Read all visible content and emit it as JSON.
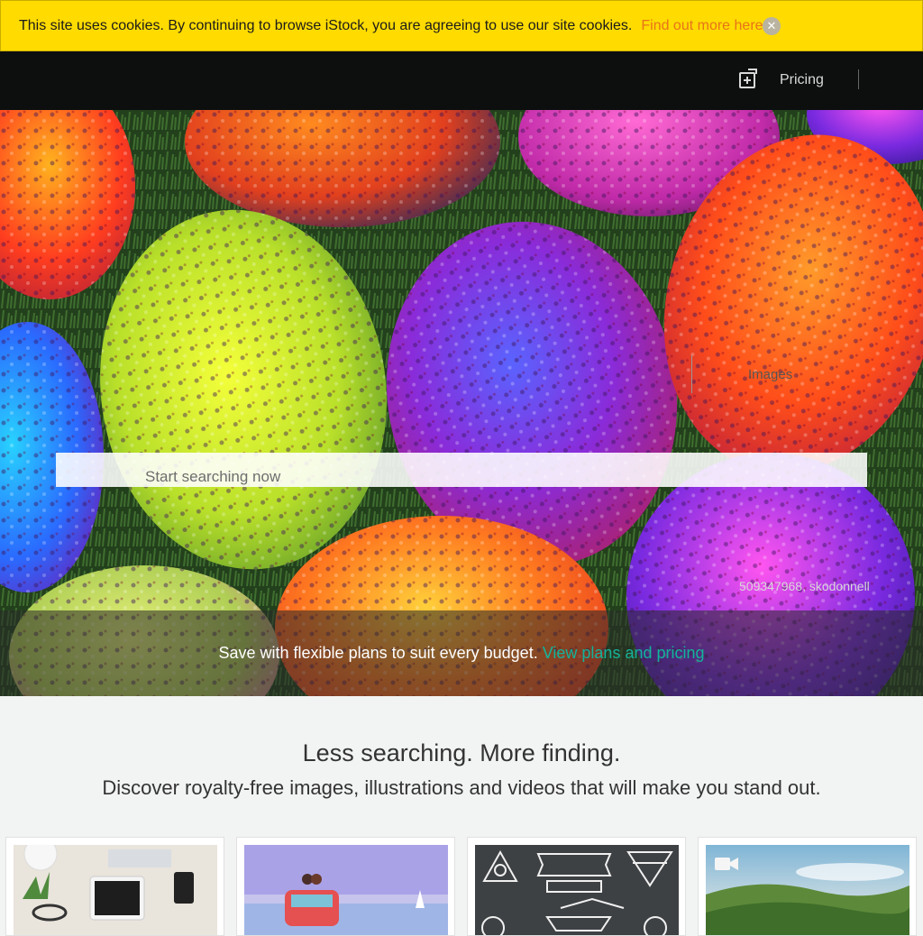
{
  "cookie": {
    "text": "This site uses cookies. By continuing to browse iStock, you are agreeing to use our site cookies.",
    "link": "Find out more here >",
    "close_icon": "close-icon"
  },
  "nav": {
    "pricing": "Pricing",
    "boards_icon": "add-board-icon"
  },
  "hero": {
    "search_placeholder": "Start searching now",
    "search_type": "Images",
    "credit": "509347968, skodonnell",
    "promo_text": "Save with flexible plans to suit every budget.",
    "promo_link": "View plans and pricing"
  },
  "intro": {
    "headline": "Less searching. More finding.",
    "subhead": "Discover royalty-free images, illustrations and videos that will make you stand out."
  },
  "cards": [
    {
      "kind": "photo"
    },
    {
      "kind": "illustration"
    },
    {
      "kind": "vector"
    },
    {
      "kind": "video",
      "icon": "video-camera-icon"
    }
  ],
  "colors": {
    "cookie_bar": "#ffdb00",
    "cookie_link": "#e8741a",
    "nav_bg": "#0d0f0f",
    "promo_link": "#13b39a"
  }
}
